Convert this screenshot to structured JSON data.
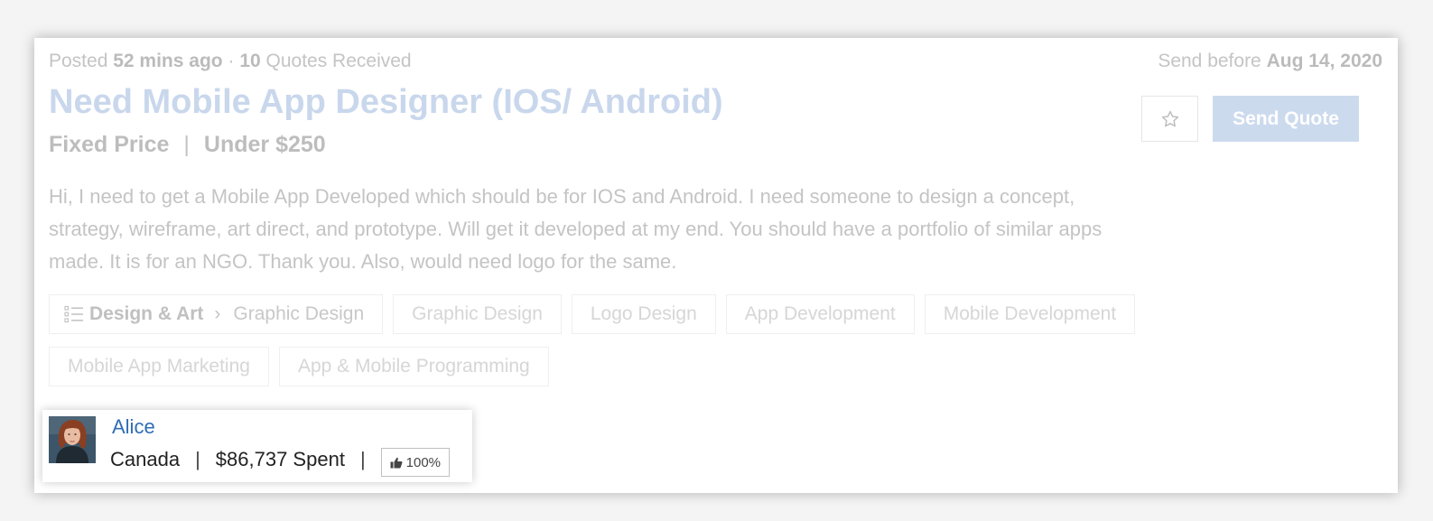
{
  "job": {
    "posted_label": "Posted",
    "posted_time": "52 mins ago",
    "dot": "·",
    "quotes_count": "10",
    "quotes_label": "Quotes Received",
    "deadline_label": "Send before",
    "deadline_date": "Aug 14, 2020",
    "title": "Need Mobile App Designer (IOS/ Android)",
    "price_type": "Fixed Price",
    "price_sep": "|",
    "price_range": "Under $250",
    "description": "Hi, I need to get a Mobile App Developed which should be for IOS and Android. I need someone to design a concept, strategy, wireframe, art direct, and prototype. Will get it developed at my end. You should have a portfolio of similar apps made. It is for an NGO. Thank you. Also, would need logo for the same.",
    "send_quote_label": "Send Quote",
    "favorite_icon": "star-outline-icon",
    "category": {
      "icon": "list-icon",
      "main": "Design & Art",
      "chevron": "›",
      "sub": "Graphic Design"
    },
    "tags": [
      "Graphic Design",
      "Logo Design",
      "App Development",
      "Mobile Development",
      "Mobile App Marketing",
      "App & Mobile Programming"
    ]
  },
  "client": {
    "name": "Alice",
    "country": "Canada",
    "bar": "|",
    "spent": "$86,737 Spent",
    "rating": "100%",
    "rating_icon": "thumbs-up-icon"
  },
  "colors": {
    "title": "#c9d7ec",
    "send_button": "#ccdaee",
    "client_name": "#2f6db5"
  }
}
